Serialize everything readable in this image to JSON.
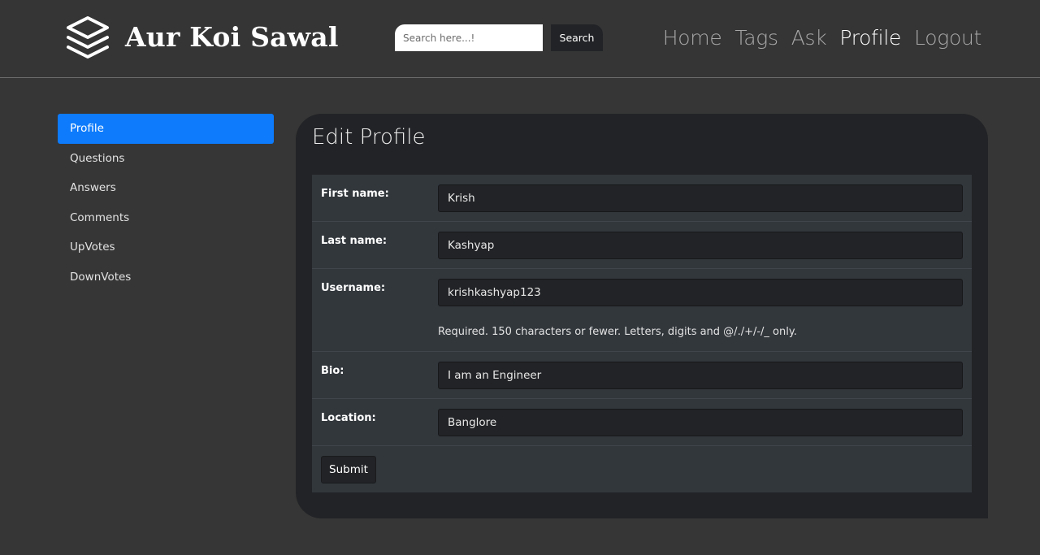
{
  "brand": {
    "name": "Aur Koi Sawal",
    "icon": "layers-icon"
  },
  "search": {
    "placeholder": "Search here...!",
    "value": "",
    "button_label": "Search"
  },
  "nav": {
    "items": [
      {
        "label": "Home",
        "active": false
      },
      {
        "label": "Tags",
        "active": false
      },
      {
        "label": "Ask",
        "active": false
      },
      {
        "label": "Profile",
        "active": true
      },
      {
        "label": "Logout",
        "active": false
      }
    ]
  },
  "sidebar": {
    "items": [
      {
        "label": "Profile",
        "active": true
      },
      {
        "label": "Questions",
        "active": false
      },
      {
        "label": "Answers",
        "active": false
      },
      {
        "label": "Comments",
        "active": false
      },
      {
        "label": "UpVotes",
        "active": false
      },
      {
        "label": "DownVotes",
        "active": false
      }
    ]
  },
  "form": {
    "title": "Edit Profile",
    "fields": {
      "first_name": {
        "label": "First name:",
        "value": "Krish"
      },
      "last_name": {
        "label": "Last name:",
        "value": "Kashyap"
      },
      "username": {
        "label": "Username:",
        "value": "krishkashyap123",
        "help": "Required. 150 characters or fewer. Letters, digits and @/./+/-/_ only."
      },
      "bio": {
        "label": "Bio:",
        "value": "I am an Engineer"
      },
      "location": {
        "label": "Location:",
        "value": "Banglore"
      }
    },
    "submit_label": "Submit"
  },
  "colors": {
    "accent": "#0d7bfb",
    "page_bg": "#363636",
    "card_bg": "#222326",
    "table_bg": "#32373c"
  }
}
